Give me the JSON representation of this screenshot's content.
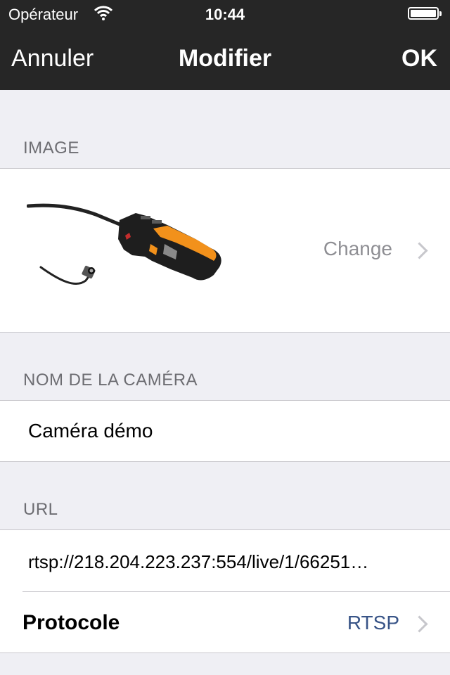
{
  "status_bar": {
    "carrier": "Opérateur",
    "time": "10:44"
  },
  "nav": {
    "cancel_label": "Annuler",
    "title": "Modifier",
    "ok_label": "OK"
  },
  "sections": {
    "image": {
      "header": "IMAGE",
      "change_label": "Change"
    },
    "camera_name": {
      "header": "NOM DE LA CAMÉRA",
      "value": "Caméra démo"
    },
    "url": {
      "header": "URL",
      "value": "rtsp://218.204.223.237:554/live/1/66251…",
      "protocol_label": "Protocole",
      "protocol_value": "RTSP"
    }
  },
  "colors": {
    "bar_bg": "#262626",
    "accent_value": "#385487",
    "secondary_text": "#8e8e93",
    "group_bg": "#efeff4"
  }
}
